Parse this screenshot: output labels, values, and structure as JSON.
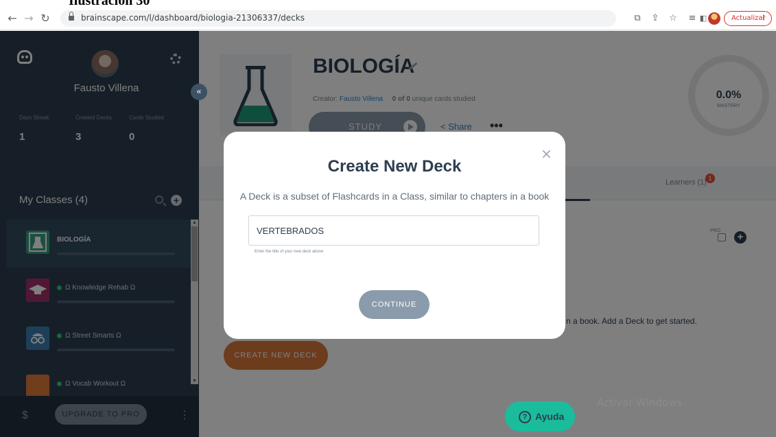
{
  "document": {
    "caption": "Ilustración 30"
  },
  "browser": {
    "url": "brainscape.com/l/dashboard/biologia-21306337/decks",
    "update_label": "Actualizar",
    "icons": [
      "back-arrow-icon",
      "forward-arrow-icon",
      "reload-icon",
      "lock-icon",
      "translate-icon",
      "share-icon",
      "star-icon",
      "reading-list-icon",
      "side-panel-icon",
      "profile-icon",
      "kebab-icon"
    ]
  },
  "sidebar": {
    "user_name": "Fausto Villena",
    "stats": [
      {
        "label": "Days Streak",
        "value": "1"
      },
      {
        "label": "Created Decks",
        "value": "3"
      },
      {
        "label": "Cards Studied",
        "value": "0"
      }
    ],
    "classes_header": "My Classes (4)",
    "classes": [
      {
        "name": "BIOLOGÍA",
        "color": "#3a9e83",
        "icon": "flask-icon"
      },
      {
        "name": "Ω Knowledge Rehab Ω",
        "color": "#a3306a",
        "icon": "graduation-cap-icon"
      },
      {
        "name": "Ω Street Smarts Ω",
        "color": "#3a80b0",
        "icon": "glasses-icon"
      },
      {
        "name": "Ω Vocab Workout Ω",
        "color": "#e07a3a",
        "icon": "book-icon"
      }
    ],
    "upgrade_label": "UPGRADE TO PRO",
    "dollar": "$"
  },
  "deck": {
    "title": "BIOLOGÍA",
    "creator_label": "Creator:",
    "creator_name": "Fausto Villena",
    "cards_studied": "0 of 0",
    "cards_suffix": "unique cards studied",
    "study_label": "STUDY",
    "share_label": "Share",
    "more_label": "•••",
    "mastery_value": "0.0%",
    "mastery_label": "MASTERY",
    "tab_learners": "Learners (1)",
    "learners_count": "1",
    "pro_label": "PRO",
    "empty_text": "n a book. Add a Deck to get started.",
    "create_deck_label": "CREATE NEW DECK",
    "accent_color": "#d9783b"
  },
  "modal": {
    "title": "Create New Deck",
    "description": "A Deck is a subset of Flashcards in a Class, similar to chapters in a book",
    "input_value": "VERTEBRADOS",
    "input_hint": "Enter the title of your new deck above",
    "continue_label": "CONTINUE",
    "close_glyph": "×"
  },
  "help": {
    "label": "Ayuda"
  },
  "watermark": "Activar Windows"
}
